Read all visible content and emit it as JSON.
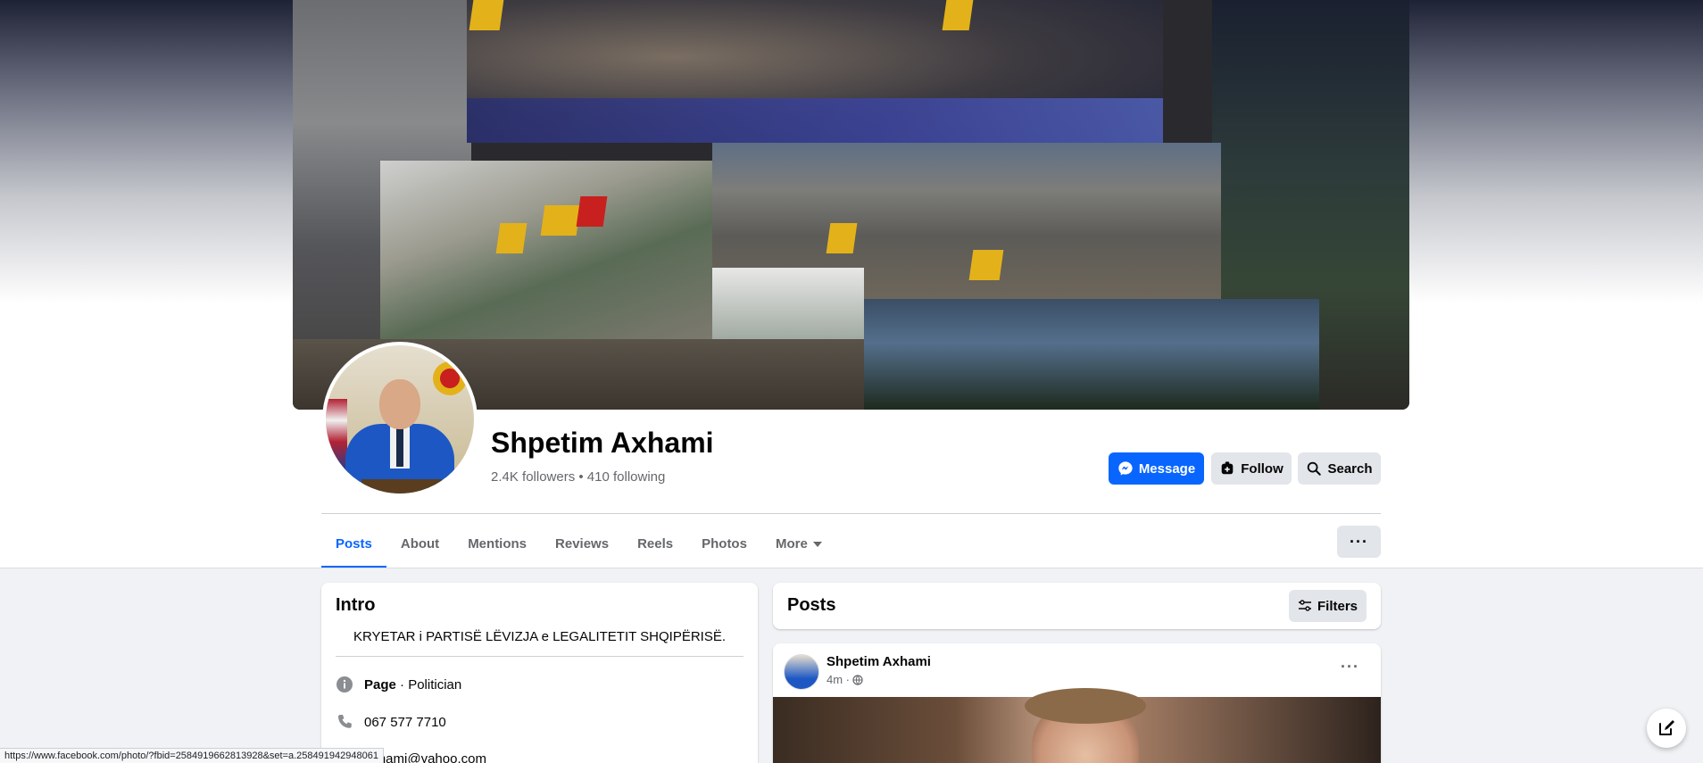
{
  "profile": {
    "name": "Shpetim Axhami",
    "follow_stats": "2.4K followers • 410 following"
  },
  "actions": {
    "message_label": "Message",
    "follow_label": "Follow",
    "search_label": "Search"
  },
  "tabs": [
    {
      "label": "Posts",
      "active": true
    },
    {
      "label": "About"
    },
    {
      "label": "Mentions"
    },
    {
      "label": "Reviews"
    },
    {
      "label": "Reels"
    },
    {
      "label": "Photos"
    },
    {
      "label": "More"
    }
  ],
  "intro": {
    "title": "Intro",
    "bio": "KRYETAR i PARTISË LËVIZJA e LEGALITETIT SHQIPËRISË.",
    "category_bold": "Page",
    "category_rest": " · Politician",
    "phone": "067 577 7710",
    "email": "axhami@yahoo.com"
  },
  "posts_section": {
    "title": "Posts",
    "filters_label": "Filters"
  },
  "post": {
    "author": "Shpetim Axhami",
    "time": "4m ·"
  },
  "status_bar": {
    "url": "https://www.facebook.com/photo/?fbid=2584919662813928&set=a.258491942948061"
  },
  "colors": {
    "accent": "#0866ff",
    "secondary_button": "#e2e5e9",
    "page_bg": "#f0f2f5"
  },
  "icons": [
    "messenger-icon",
    "follow-icon",
    "search-icon",
    "more-dots-icon",
    "info-icon",
    "phone-icon",
    "email-icon",
    "filters-icon",
    "globe-icon",
    "compose-icon",
    "caret-down-icon"
  ]
}
